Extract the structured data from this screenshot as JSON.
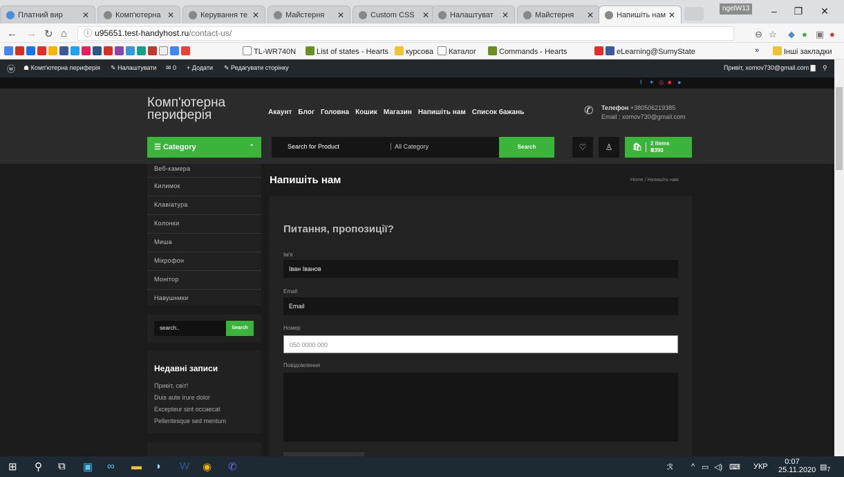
{
  "browser": {
    "tabs": [
      {
        "label": "Платний вир",
        "active": false
      },
      {
        "label": "Комп'ютерна",
        "active": false
      },
      {
        "label": "Керування те",
        "active": false
      },
      {
        "label": "Майстерня",
        "active": false
      },
      {
        "label": "Custom CSS",
        "active": false
      },
      {
        "label": "Налаштуват",
        "active": false
      },
      {
        "label": "Майстерня",
        "active": false
      },
      {
        "label": "Напишіть нам",
        "active": true
      }
    ],
    "profile": "ngelW13",
    "url_host": "u95651.test-handyhost.ru",
    "url_path": "/contact-us/",
    "bookmarks": [
      "TL-WR740N",
      "List of states - Hearts",
      "курсова",
      "Каталог",
      "Commands - Hearts",
      "eLearning@SumyState",
      "Інші закладки"
    ]
  },
  "wpadmin": {
    "site": "Комп'ютерна периферія",
    "customize": "Налаштувати",
    "comments": "0",
    "add": "Додати",
    "edit": "Редагувати сторінку",
    "greeting": "Привіт, xomov730@gmail.com"
  },
  "header": {
    "logo": "Комп'ютерна периферія",
    "nav": [
      "Акаунт",
      "Блог",
      "Головна",
      "Кошик",
      "Магазин",
      "Напишіть нам",
      "Список бажань"
    ],
    "phone_label": "Телефон",
    "phone": "+380506219385",
    "email": "Email : xomov730@gmail.com",
    "category_btn": "Category",
    "search_placeholder": "Search for Product",
    "search_category": "All Category",
    "search_btn": "Search",
    "cart_items": "2 items",
    "cart_total": "₴390"
  },
  "sidebar": {
    "categories": [
      "Веб-камера",
      "Килимок",
      "Клавіатура",
      "Колонки",
      "Миша",
      "Мікрофон",
      "Монітор",
      "Навушники"
    ],
    "search_value": "search..",
    "search_btn": "Search",
    "recent_title": "Недавні записи",
    "recent_posts": [
      "Привіт, світ!",
      "Duis aute irure dolor",
      "Excepteur sint occaecat",
      "Pellentesque sed mentum"
    ]
  },
  "page": {
    "title": "Напишіть нам",
    "breadcrumb": "Home / Напишіть нам",
    "form_heading": "Питання, пропозиції?",
    "name_label": "Ім'я",
    "name_value": "Іван Іванов",
    "email_label": "Email",
    "email_value": "Email",
    "number_label": "Номер",
    "number_placeholder": "050 0000 000",
    "message_label": "Повідомлення"
  },
  "taskbar": {
    "lang": "УКР",
    "time": "0:07",
    "date": "25.11.2020",
    "notif": "7"
  }
}
